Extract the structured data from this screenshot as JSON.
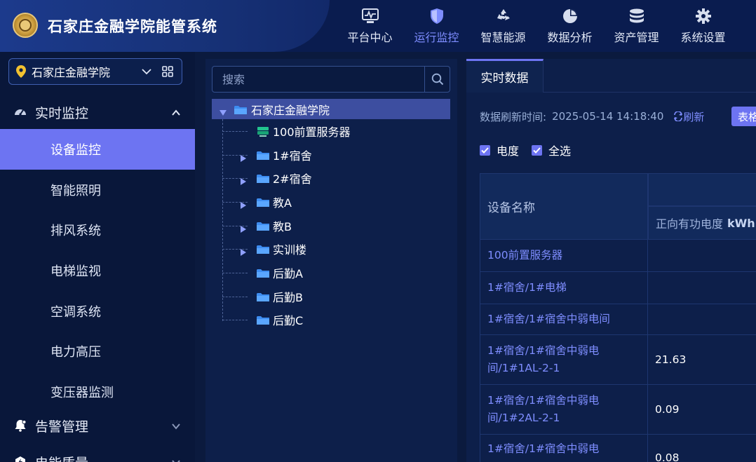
{
  "app": {
    "title": "石家庄金融学院能管系统"
  },
  "nav": [
    {
      "label": "平台中心",
      "icon": "monitor-pulse-icon",
      "active": false
    },
    {
      "label": "运行监控",
      "icon": "shield-icon",
      "active": true
    },
    {
      "label": "智慧能源",
      "icon": "recycle-icon",
      "active": false
    },
    {
      "label": "数据分析",
      "icon": "pie-chart-icon",
      "active": false
    },
    {
      "label": "资产管理",
      "icon": "database-icon",
      "active": false
    },
    {
      "label": "系统设置",
      "icon": "gear-icon",
      "active": false
    }
  ],
  "sidebar": {
    "org_name": "石家庄金融学院",
    "groups": [
      {
        "label": "实时监控",
        "icon": "dashboard-gauge-icon",
        "expanded": true
      },
      {
        "label": "告警管理",
        "icon": "alarm-bell-icon",
        "expanded": false
      },
      {
        "label": "电能质量",
        "icon": "power-quality-icon",
        "expanded": false
      }
    ],
    "sub_items": [
      {
        "label": "设备监控",
        "active": true
      },
      {
        "label": "智能照明",
        "active": false
      },
      {
        "label": "排风系统",
        "active": false
      },
      {
        "label": "电梯监视",
        "active": false
      },
      {
        "label": "空调系统",
        "active": false
      },
      {
        "label": "电力高压",
        "active": false
      },
      {
        "label": "变压器监测",
        "active": false
      }
    ]
  },
  "tree": {
    "search_placeholder": "搜索",
    "root": "石家庄金融学院",
    "nodes": [
      {
        "label": "100前置服务器",
        "type": "server",
        "expandable": false
      },
      {
        "label": "1#宿舍",
        "type": "folder",
        "expandable": true
      },
      {
        "label": "2#宿舍",
        "type": "folder",
        "expandable": true
      },
      {
        "label": "教A",
        "type": "folder",
        "expandable": true
      },
      {
        "label": "教B",
        "type": "folder",
        "expandable": true
      },
      {
        "label": "实训楼",
        "type": "folder",
        "expandable": true
      },
      {
        "label": "后勤A",
        "type": "folder",
        "expandable": false
      },
      {
        "label": "后勤B",
        "type": "folder",
        "expandable": false
      },
      {
        "label": "后勤C",
        "type": "folder",
        "expandable": false
      }
    ]
  },
  "panel": {
    "tab": "实时数据",
    "refresh_label": "数据刷新时间:",
    "refresh_time": "2025-05-14 14:18:40",
    "refresh_link": "刷新",
    "table_button": "表格",
    "checks": [
      {
        "label": "电度",
        "checked": true
      },
      {
        "label": "全选",
        "checked": true
      }
    ],
    "table": {
      "col_name": "设备名称",
      "col_value": "正向有功电度",
      "col_unit": "kWh",
      "rows": [
        {
          "name": "100前置服务器",
          "value": ""
        },
        {
          "name": "1#宿舍/1#电梯",
          "value": ""
        },
        {
          "name": "1#宿舍/1#宿舍中弱电间",
          "value": ""
        },
        {
          "name_line1": "1#宿舍/1#宿舍中弱电",
          "name_line2": "间/1#1AL-2-1",
          "value": "21.63"
        },
        {
          "name_line1": "1#宿舍/1#宿舍中弱电",
          "name_line2": "间/1#2AL-2-1",
          "value": "0.09"
        },
        {
          "name_line1": "1#宿舍/1#宿舍中弱电",
          "name_line2": "",
          "value": "0.08"
        }
      ]
    }
  },
  "colors": {
    "accent": "#6d74f2",
    "header_bg": "#0a1c4f",
    "panel_bg": "#0d1f4a"
  }
}
